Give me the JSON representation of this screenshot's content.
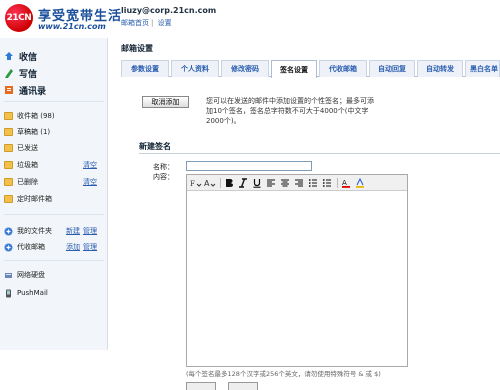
{
  "brand": {
    "logo_text": "21CN",
    "title": "享受宽带生活",
    "url": "www.21cn.com"
  },
  "header": {
    "email": "liuzy@corp.21cn.com",
    "links": [
      "邮箱首页",
      "设置"
    ],
    "separator": "|"
  },
  "sidebar": {
    "main_links": [
      {
        "label": "收信",
        "icon": "inbox-icon"
      },
      {
        "label": "写信",
        "icon": "compose-icon"
      },
      {
        "label": "通讯录",
        "icon": "contacts-icon"
      }
    ],
    "folders": [
      {
        "label": "收件箱 (98)",
        "action": ""
      },
      {
        "label": "草稿箱 (1)",
        "action": ""
      },
      {
        "label": "已发送",
        "action": ""
      },
      {
        "label": "垃圾箱",
        "action": "清空"
      },
      {
        "label": "已删除",
        "action": "清空"
      },
      {
        "label": "定时邮件箱",
        "action": ""
      }
    ],
    "my_folders": {
      "label": "我的文件夹",
      "actions": [
        "新建",
        "管理"
      ]
    },
    "proxy_mail": {
      "label": "代收邮箱",
      "actions": [
        "添加",
        "管理"
      ]
    },
    "extras": [
      {
        "label": "网络硬盘"
      },
      {
        "label": "PushMail"
      }
    ]
  },
  "main": {
    "title": "邮箱设置",
    "tabs": [
      "参数设置",
      "个人资料",
      "修改密码",
      "签名设置",
      "代收邮箱",
      "自动回复",
      "自动转发",
      "黑白名单"
    ],
    "active_tab": "签名设置",
    "cancel_button": "取消添加",
    "description": "您可以在发送的邮件中添加设置的个性签名；最多可添加10个签名，签名总字符数不可大于4000个(中文字2000个)。",
    "section_title": "新建签名",
    "name_label": "名称：",
    "content_label": "内容：",
    "name_value": "",
    "hint": "(每个签名最多128个汉字或256个英文，请勿使用特殊符号 & 或 $)"
  },
  "colors": {
    "accent": "#2a5db0",
    "brand_red": "#cc0000",
    "sidebar_bg": "#f2f5f9"
  }
}
